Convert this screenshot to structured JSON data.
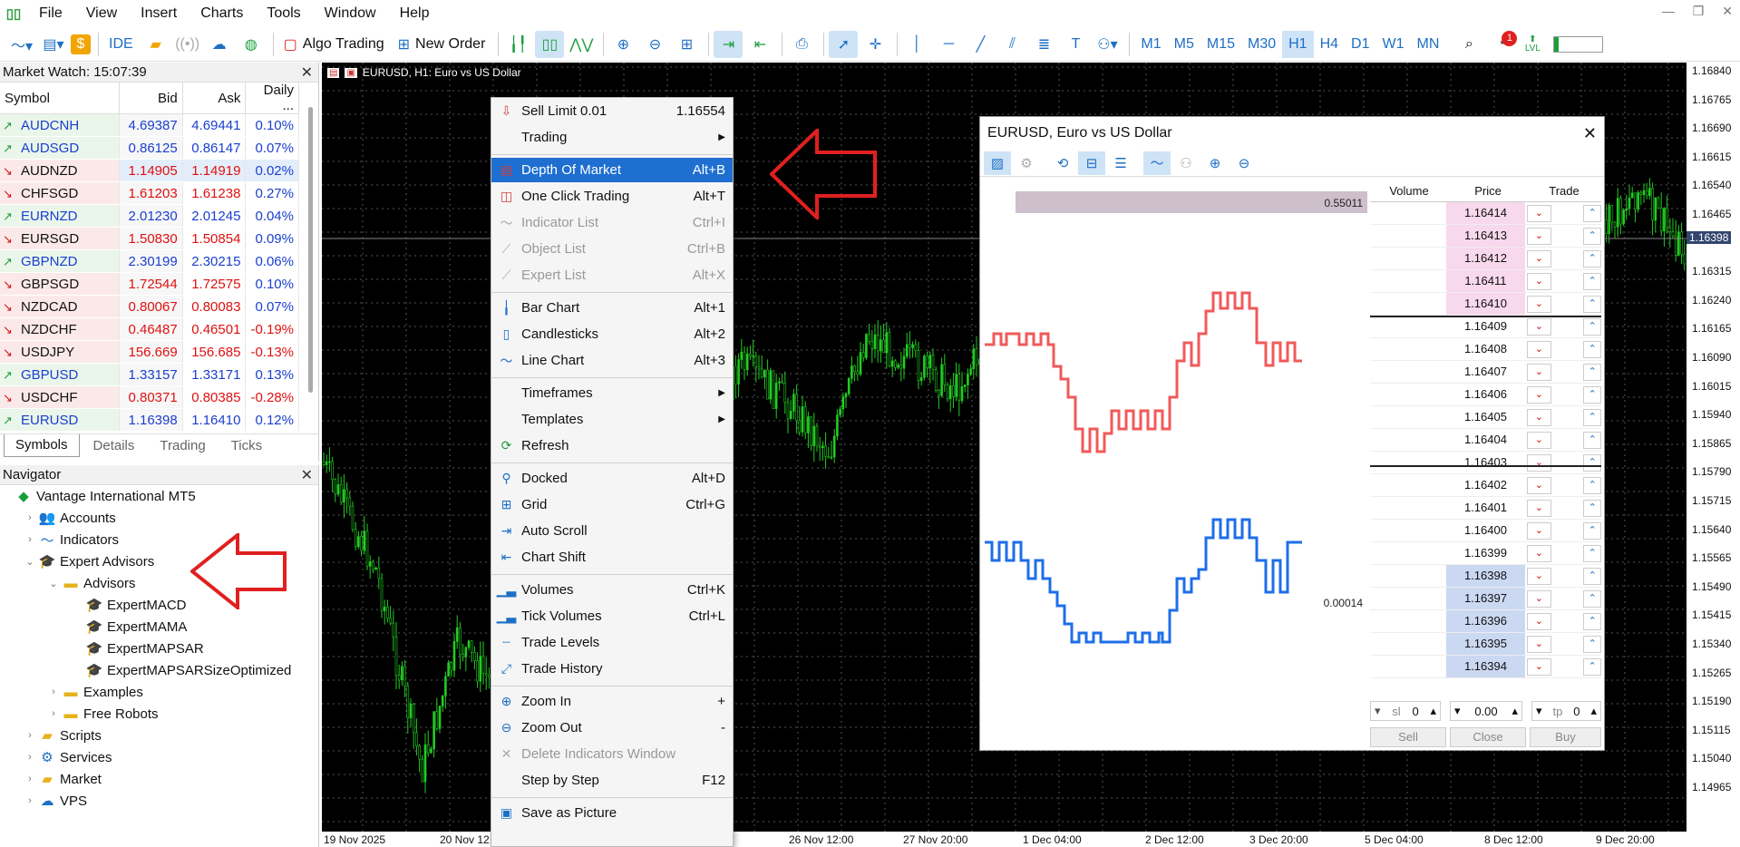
{
  "menubar": {
    "items": [
      "File",
      "View",
      "Insert",
      "Charts",
      "Tools",
      "Window",
      "Help"
    ]
  },
  "toolbar": {
    "ide_label": "IDE",
    "algo_trading_label": "Algo Trading",
    "new_order_label": "New Order",
    "timeframes": [
      "M1",
      "M5",
      "M15",
      "M30",
      "H1",
      "H4",
      "D1",
      "W1",
      "MN"
    ],
    "active_timeframe": "H1",
    "notification_count": "1",
    "lvl_label": "LVL"
  },
  "market_watch": {
    "title": "Market Watch: 15:07:39",
    "columns": [
      "Symbol",
      "Bid",
      "Ask",
      "Daily ..."
    ],
    "rows": [
      {
        "symbol": "AUDCNH",
        "bid": "4.69387",
        "ask": "4.69441",
        "daily": "0.10%",
        "dir": "up"
      },
      {
        "symbol": "AUDSGD",
        "bid": "0.86125",
        "ask": "0.86147",
        "daily": "0.07%",
        "dir": "up"
      },
      {
        "symbol": "AUDNZD",
        "bid": "1.14905",
        "ask": "1.14919",
        "daily": "0.02%",
        "dir": "down"
      },
      {
        "symbol": "CHFSGD",
        "bid": "1.61203",
        "ask": "1.61238",
        "daily": "0.27%",
        "dir": "down"
      },
      {
        "symbol": "EURNZD",
        "bid": "2.01230",
        "ask": "2.01245",
        "daily": "0.04%",
        "dir": "up"
      },
      {
        "symbol": "EURSGD",
        "bid": "1.50830",
        "ask": "1.50854",
        "daily": "0.09%",
        "dir": "down"
      },
      {
        "symbol": "GBPNZD",
        "bid": "2.30199",
        "ask": "2.30215",
        "daily": "0.06%",
        "dir": "up"
      },
      {
        "symbol": "GBPSGD",
        "bid": "1.72544",
        "ask": "1.72575",
        "daily": "0.10%",
        "dir": "down"
      },
      {
        "symbol": "NZDCAD",
        "bid": "0.80067",
        "ask": "0.80083",
        "daily": "0.07%",
        "dir": "down"
      },
      {
        "symbol": "NZDCHF",
        "bid": "0.46487",
        "ask": "0.46501",
        "daily": "-0.19%",
        "dir": "down"
      },
      {
        "symbol": "USDJPY",
        "bid": "156.669",
        "ask": "156.685",
        "daily": "-0.13%",
        "dir": "down"
      },
      {
        "symbol": "GBPUSD",
        "bid": "1.33157",
        "ask": "1.33171",
        "daily": "0.13%",
        "dir": "up"
      },
      {
        "symbol": "USDCHF",
        "bid": "0.80371",
        "ask": "0.80385",
        "daily": "-0.28%",
        "dir": "down"
      },
      {
        "symbol": "EURUSD",
        "bid": "1.16398",
        "ask": "1.16410",
        "daily": "0.12%",
        "dir": "up"
      }
    ],
    "tabs": [
      "Symbols",
      "Details",
      "Trading",
      "Ticks"
    ],
    "active_tab": "Symbols"
  },
  "navigator": {
    "title": "Navigator",
    "items": [
      {
        "label": "Vantage International MT5",
        "level": 0,
        "icon": "mt5-logo-icon",
        "expander": ""
      },
      {
        "label": "Accounts",
        "level": 1,
        "icon": "accounts-icon",
        "expander": "›"
      },
      {
        "label": "Indicators",
        "level": 1,
        "icon": "indicators-icon",
        "expander": "›"
      },
      {
        "label": "Expert Advisors",
        "level": 1,
        "icon": "expert-advisor-icon",
        "expander": "⌄"
      },
      {
        "label": "Advisors",
        "level": 2,
        "icon": "folder-icon",
        "expander": "⌄"
      },
      {
        "label": "ExpertMACD",
        "level": 3,
        "icon": "expert-advisor-icon",
        "expander": ""
      },
      {
        "label": "ExpertMAMA",
        "level": 3,
        "icon": "expert-advisor-icon",
        "expander": ""
      },
      {
        "label": "ExpertMAPSAR",
        "level": 3,
        "icon": "expert-advisor-icon",
        "expander": ""
      },
      {
        "label": "ExpertMAPSARSizeOptimized",
        "level": 3,
        "icon": "expert-advisor-icon",
        "expander": ""
      },
      {
        "label": "Examples",
        "level": 2,
        "icon": "folder-icon",
        "expander": "›"
      },
      {
        "label": "Free Robots",
        "level": 2,
        "icon": "folder-icon",
        "expander": "›"
      },
      {
        "label": "Scripts",
        "level": 1,
        "icon": "scripts-icon",
        "expander": "›"
      },
      {
        "label": "Services",
        "level": 1,
        "icon": "services-icon",
        "expander": "›"
      },
      {
        "label": "Market",
        "level": 1,
        "icon": "market-icon",
        "expander": "›"
      },
      {
        "label": "VPS",
        "level": 1,
        "icon": "vps-icon",
        "expander": "›"
      }
    ]
  },
  "chart": {
    "header": "EURUSD, H1:  Euro vs US Dollar",
    "price_labels": [
      "1.16840",
      "1.16765",
      "1.16690",
      "1.16615",
      "1.16540",
      "1.16465",
      "1.16398",
      "1.16315",
      "1.16240",
      "1.16165",
      "1.16090",
      "1.16015",
      "1.15940",
      "1.15865",
      "1.15790",
      "1.15715",
      "1.15640",
      "1.15565",
      "1.15490",
      "1.15415",
      "1.15340",
      "1.15265",
      "1.15190",
      "1.15115",
      "1.15040",
      "1.14965"
    ],
    "current_price": "1.16398",
    "time_labels": [
      "19 Nov 2025",
      "20 Nov 12:",
      "26 Nov 12:00",
      "27 Nov 20:00",
      "1 Dec 04:00",
      "2 Dec 12:00",
      "3 Dec 20:00",
      "5 Dec 04:00",
      "8 Dec 12:00",
      "9 Dec 20:00"
    ]
  },
  "context_menu": {
    "items": [
      {
        "label": "Sell Limit 0.01",
        "shortcut": "1.16554",
        "icon": "sell-limit-icon",
        "state": "normal",
        "sub": false
      },
      {
        "label": "Trading",
        "shortcut": "",
        "icon": "",
        "state": "normal",
        "sub": true
      },
      {
        "sep": true
      },
      {
        "label": "Depth Of Market",
        "shortcut": "Alt+B",
        "icon": "depth-of-market-icon",
        "state": "highlight",
        "sub": false
      },
      {
        "label": "One Click Trading",
        "shortcut": "Alt+T",
        "icon": "one-click-trading-icon",
        "state": "normal",
        "sub": false
      },
      {
        "label": "Indicator List",
        "shortcut": "Ctrl+I",
        "icon": "indicator-list-icon",
        "state": "disabled",
        "sub": false
      },
      {
        "label": "Object List",
        "shortcut": "Ctrl+B",
        "icon": "object-list-icon",
        "state": "disabled",
        "sub": false
      },
      {
        "label": "Expert List",
        "shortcut": "Alt+X",
        "icon": "expert-list-icon",
        "state": "disabled",
        "sub": false
      },
      {
        "sep": true
      },
      {
        "label": "Bar Chart",
        "shortcut": "Alt+1",
        "icon": "bar-chart-icon",
        "state": "normal",
        "sub": false
      },
      {
        "label": "Candlesticks",
        "shortcut": "Alt+2",
        "icon": "candlesticks-icon",
        "state": "normal",
        "sub": false
      },
      {
        "label": "Line Chart",
        "shortcut": "Alt+3",
        "icon": "line-chart-icon",
        "state": "normal",
        "sub": false
      },
      {
        "sep": true
      },
      {
        "label": "Timeframes",
        "shortcut": "",
        "icon": "",
        "state": "normal",
        "sub": true
      },
      {
        "label": "Templates",
        "shortcut": "",
        "icon": "",
        "state": "normal",
        "sub": true
      },
      {
        "label": "Refresh",
        "shortcut": "",
        "icon": "refresh-icon",
        "state": "normal",
        "sub": false
      },
      {
        "sep": true
      },
      {
        "label": "Docked",
        "shortcut": "Alt+D",
        "icon": "docked-icon",
        "state": "normal",
        "sub": false
      },
      {
        "label": "Grid",
        "shortcut": "Ctrl+G",
        "icon": "grid-icon",
        "state": "normal",
        "sub": false
      },
      {
        "label": "Auto Scroll",
        "shortcut": "",
        "icon": "auto-scroll-icon",
        "state": "normal",
        "sub": false
      },
      {
        "label": "Chart Shift",
        "shortcut": "",
        "icon": "chart-shift-icon",
        "state": "normal",
        "sub": false
      },
      {
        "sep": true
      },
      {
        "label": "Volumes",
        "shortcut": "Ctrl+K",
        "icon": "volumes-icon",
        "state": "normal",
        "sub": false
      },
      {
        "label": "Tick Volumes",
        "shortcut": "Ctrl+L",
        "icon": "tick-volumes-icon",
        "state": "normal",
        "sub": false
      },
      {
        "label": "Trade Levels",
        "shortcut": "",
        "icon": "trade-levels-icon",
        "state": "normal",
        "sub": false
      },
      {
        "label": "Trade History",
        "shortcut": "",
        "icon": "trade-history-icon",
        "state": "normal",
        "sub": false
      },
      {
        "sep": true
      },
      {
        "label": "Zoom In",
        "shortcut": "+",
        "icon": "zoom-in-icon",
        "state": "normal",
        "sub": false
      },
      {
        "label": "Zoom Out",
        "shortcut": "-",
        "icon": "zoom-out-icon",
        "state": "normal",
        "sub": false
      },
      {
        "label": "Delete Indicators Window",
        "shortcut": "",
        "icon": "delete-icon",
        "state": "disabled",
        "sub": false
      },
      {
        "label": "Step by Step",
        "shortcut": "F12",
        "icon": "",
        "state": "normal",
        "sub": false
      },
      {
        "sep": true
      },
      {
        "label": "Save as Picture",
        "shortcut": "",
        "icon": "save-picture-icon",
        "state": "normal",
        "sub": false
      }
    ]
  },
  "dom_window": {
    "title": "EURUSD, Euro vs US Dollar",
    "headers": [
      "Volume",
      "Price",
      "Trade"
    ],
    "bar_value": "0.55011",
    "bottom_value": "0.00014",
    "rows": [
      {
        "price": "1.16414",
        "type": "ask"
      },
      {
        "price": "1.16413",
        "type": "ask"
      },
      {
        "price": "1.16412",
        "type": "ask"
      },
      {
        "price": "1.16411",
        "type": "ask"
      },
      {
        "price": "1.16410",
        "type": "ask"
      },
      {
        "price": "1.16409",
        "type": "mid"
      },
      {
        "price": "1.16408",
        "type": "mid"
      },
      {
        "price": "1.16407",
        "type": "mid"
      },
      {
        "price": "1.16406",
        "type": "mid"
      },
      {
        "price": "1.16405",
        "type": "mid"
      },
      {
        "price": "1.16404",
        "type": "mid"
      },
      {
        "price": "1.16403",
        "type": "mid"
      },
      {
        "price": "1.16402",
        "type": "mid"
      },
      {
        "price": "1.16401",
        "type": "mid"
      },
      {
        "price": "1.16400",
        "type": "mid"
      },
      {
        "price": "1.16399",
        "type": "mid"
      },
      {
        "price": "1.16398",
        "type": "bid"
      },
      {
        "price": "1.16397",
        "type": "bid"
      },
      {
        "price": "1.16396",
        "type": "bid"
      },
      {
        "price": "1.16395",
        "type": "bid"
      },
      {
        "price": "1.16394",
        "type": "bid"
      }
    ],
    "sl_label": "sl",
    "sl_value": "0",
    "volume_value": "0.00",
    "tp_label": "tp",
    "tp_value": "0",
    "sell_label": "Sell",
    "close_label": "Close",
    "buy_label": "Buy"
  },
  "colors": {
    "ask_line": "#f05a5a",
    "bid_line": "#1e6ee8",
    "candle": "#22cc22",
    "highlight": "#1e6fd0",
    "arrow": "#e02020"
  }
}
